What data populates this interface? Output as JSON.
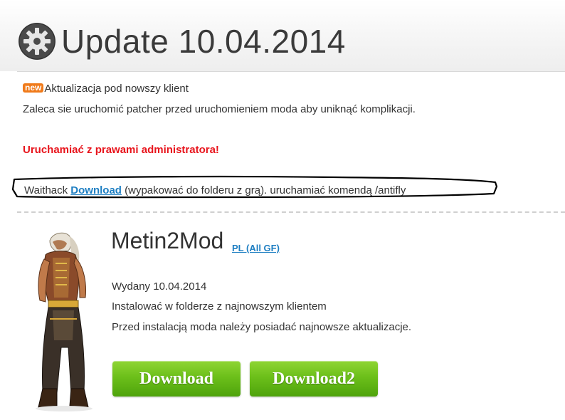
{
  "header": {
    "title": "Update 10.04.2014"
  },
  "notes": {
    "badge": "new",
    "line1": "Aktualizacja pod nowszy klient",
    "line2": "Zaleca sie uruchomić patcher przed uruchomieniem moda aby uniknąć komplikacji.",
    "warning": "Uruchamiać z prawami administratora!",
    "waithack_prefix": "Waithack ",
    "waithack_link": "Download",
    "waithack_suffix": " (wypakować do folderu z grą). uruchamiać komendą /antifly"
  },
  "product": {
    "name": "Metin2Mod",
    "variant": "PL (All GF)",
    "released": "Wydany 10.04.2014",
    "install_note": "Instalować w folderze z najnowszym klientem",
    "update_note": "Przed instalacją moda należy posiadać najnowsze aktualizacje."
  },
  "buttons": {
    "download1": "Download",
    "download2": "Download2"
  },
  "colors": {
    "warning": "#e8141c",
    "link": "#1d7ec2",
    "button_green": "#6cbf1a",
    "badge": "#f07a1a"
  }
}
